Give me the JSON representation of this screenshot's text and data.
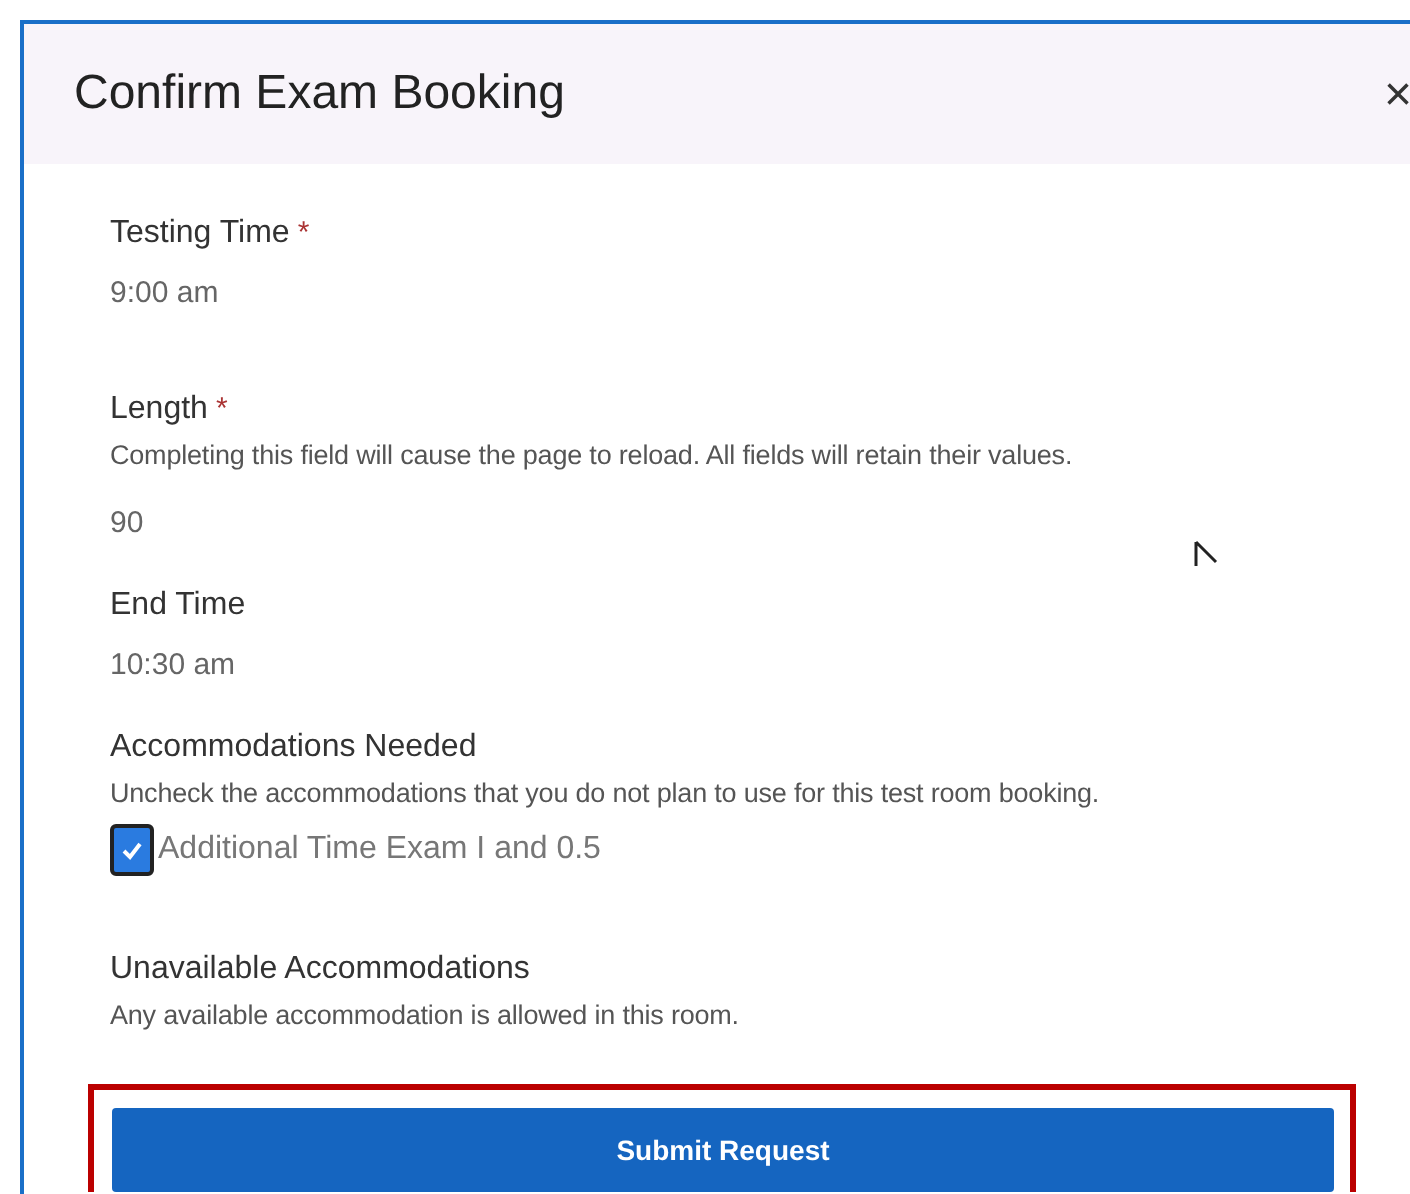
{
  "dialog": {
    "title": "Confirm Exam Booking",
    "close": "×"
  },
  "fields": [
    {
      "label": "Testing Time",
      "marker": "*",
      "value": "9:00 am"
    },
    {
      "label": "Length",
      "marker": "*",
      "help": "Completing this field will cause the page to reload. All fields will retain their values.",
      "value": "90"
    },
    {
      "label": "End Time",
      "value": "10:30 am"
    },
    {
      "label": "Accommodations Needed",
      "help": "Uncheck the accommodations that you do not plan to use for this test room booking.",
      "options": [
        {
          "label": "Additional Time Exam I and 0.5",
          "checked": true
        }
      ]
    },
    {
      "label": "Unavailable Accommodations",
      "help": "Any available accommodation is allowed in this room."
    }
  ],
  "submit": {
    "label": "Submit Request",
    "highlighted": true
  }
}
